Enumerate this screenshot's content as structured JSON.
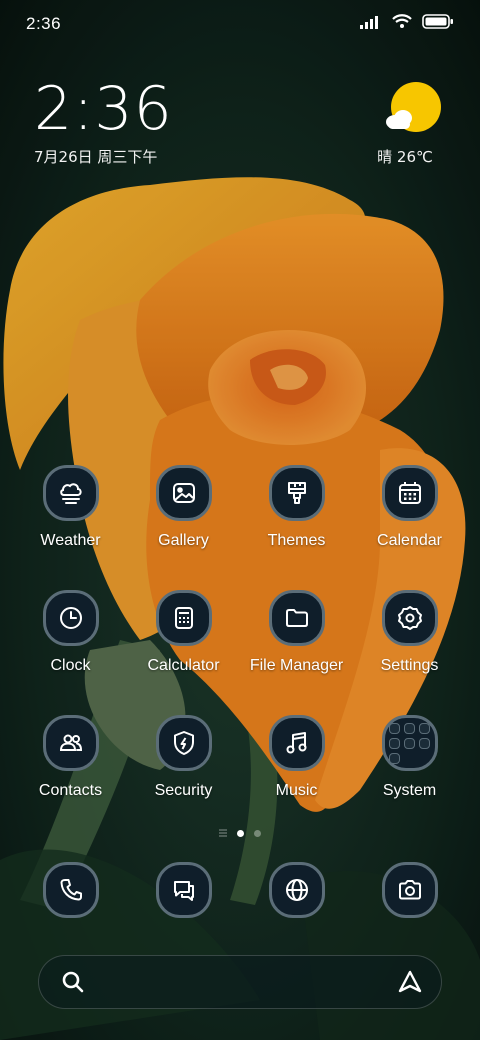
{
  "status_bar": {
    "time": "2:36",
    "icons": [
      "signal-icon",
      "wifi-icon",
      "battery-icon"
    ]
  },
  "clock_widget": {
    "time": "2:36",
    "date": "7月26日 周三下午"
  },
  "weather_widget": {
    "icon": "sun-cloud-icon",
    "text": "晴 26℃"
  },
  "apps": [
    {
      "label": "Weather",
      "icon": "weather-icon"
    },
    {
      "label": "Gallery",
      "icon": "gallery-icon"
    },
    {
      "label": "Themes",
      "icon": "brush-icon"
    },
    {
      "label": "Calendar",
      "icon": "calendar-icon"
    },
    {
      "label": "Clock",
      "icon": "clock-icon"
    },
    {
      "label": "Calculator",
      "icon": "calculator-icon"
    },
    {
      "label": "File Manager",
      "icon": "folder-icon"
    },
    {
      "label": "Settings",
      "icon": "gear-icon"
    },
    {
      "label": "Contacts",
      "icon": "contacts-icon"
    },
    {
      "label": "Security",
      "icon": "shield-icon"
    },
    {
      "label": "Music",
      "icon": "music-note-icon"
    },
    {
      "label": "System",
      "icon": "folder-grid-icon"
    }
  ],
  "page_indicator": {
    "pages": 2,
    "current": 1
  },
  "dock": [
    {
      "icon": "phone-icon"
    },
    {
      "icon": "messages-icon"
    },
    {
      "icon": "browser-icon"
    },
    {
      "icon": "camera-icon"
    }
  ],
  "search_bar": {
    "left_icon": "search-icon",
    "right_icon": "assistant-icon"
  },
  "colors": {
    "icon_background": "#0f1e2a",
    "icon_border": "#5b6d78",
    "sun": "#f7c600"
  }
}
